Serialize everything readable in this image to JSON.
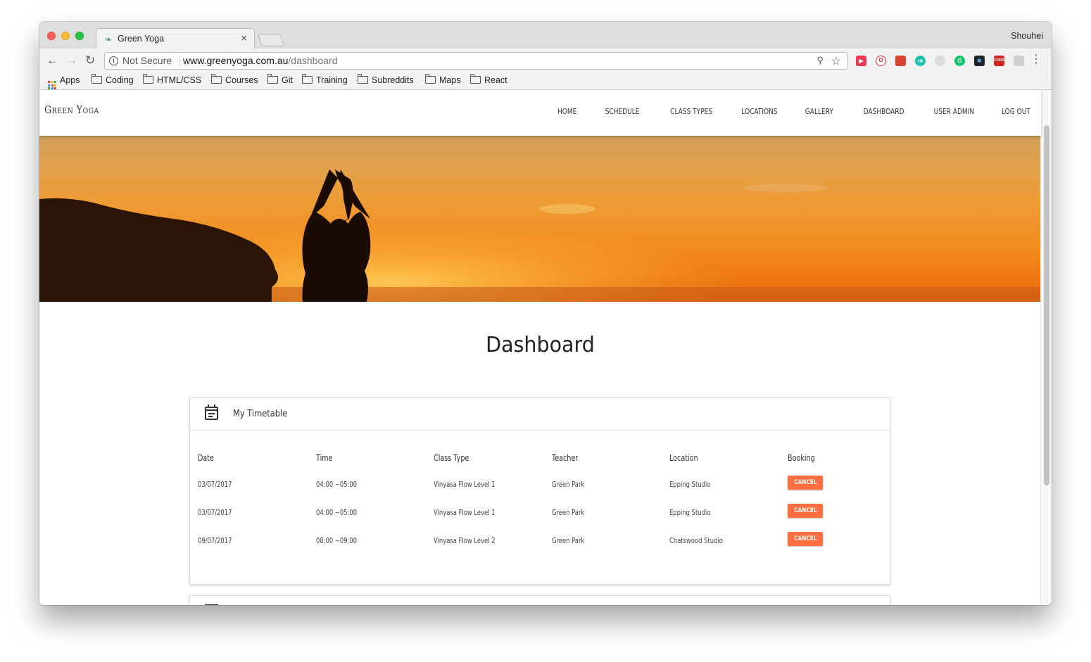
{
  "browser": {
    "tab_title": "Green Yoga",
    "profile_name": "Shouhei",
    "security_label": "Not Secure",
    "url_host": "www.greenyoga.com.au",
    "url_path": "/dashboard",
    "bookmarks": [
      "Apps",
      "Coding",
      "HTML/CSS",
      "Courses",
      "Git",
      "Training",
      "Subreddits",
      "Maps",
      "React"
    ],
    "extensions": [
      {
        "name": "pocket-extension-icon",
        "color": "#e8384f",
        "glyph": "▶"
      },
      {
        "name": "opera-extension-icon",
        "color": "#ffffff",
        "glyph": "O"
      },
      {
        "name": "bookmark-extension-icon",
        "color": "#d64530",
        "glyph": ""
      },
      {
        "name": "m-extension-icon",
        "color": "#1bbfb0",
        "glyph": "m"
      },
      {
        "name": "circle-extension-icon",
        "color": "#dcdcdc",
        "glyph": ""
      },
      {
        "name": "grammarly-extension-icon",
        "color": "#15c26b",
        "glyph": "G"
      },
      {
        "name": "react-devtools-icon",
        "color": "#20232a",
        "glyph": "⚛"
      },
      {
        "name": "cors-extension-icon",
        "color": "#d0241b",
        "glyph": "CORS"
      },
      {
        "name": "cloud-extension-icon",
        "color": "#cfcfcf",
        "glyph": ""
      }
    ]
  },
  "site": {
    "brand": "Green Yoga",
    "nav": [
      "HOME",
      "SCHEDULE",
      "CLASS TYPES",
      "LOCATIONS",
      "GALLERY",
      "DASHBOARD",
      "USER ADMIN",
      "LOG OUT"
    ]
  },
  "dashboard": {
    "title": "Dashboard",
    "timetable": {
      "heading": "My Timetable",
      "columns": [
        "Date",
        "Time",
        "Class Type",
        "Teacher",
        "Location",
        "Booking"
      ],
      "rows": [
        {
          "date": "03/07/2017",
          "time": "04:00 ~05:00",
          "class_type": "Vinyasa Flow Level 1",
          "teacher": "Green Park",
          "location": "Epping Studio",
          "action": "CANCEL"
        },
        {
          "date": "03/07/2017",
          "time": "04:00 ~05:00",
          "class_type": "Vinyasa Flow Level 1",
          "teacher": "Green Park",
          "location": "Epping Studio",
          "action": "CANCEL"
        },
        {
          "date": "09/07/2017",
          "time": "08:00 ~09:00",
          "class_type": "Vinyasa Flow Level 2",
          "teacher": "Green Park",
          "location": "Chatswood Studio",
          "action": "CANCEL"
        }
      ]
    }
  },
  "colors": {
    "accent": "#ff6e40",
    "hero_sky": "#f28d1f"
  }
}
